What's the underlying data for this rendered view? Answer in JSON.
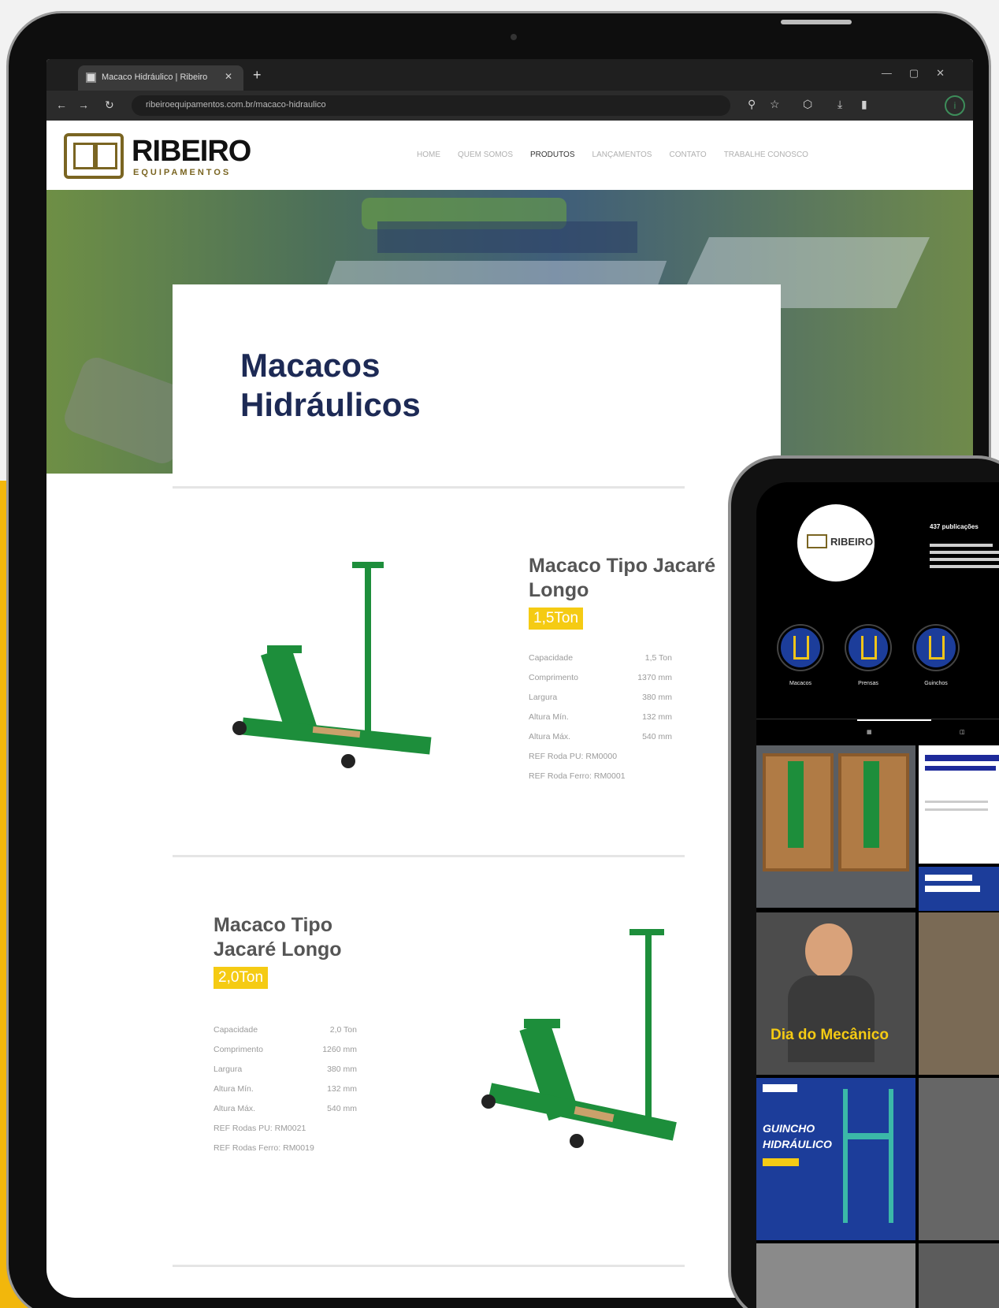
{
  "browser": {
    "tab_title": "Macaco Hidráulico | Ribeiro",
    "url": "ribeiroequipamentos.com.br/macaco-hidraulico",
    "profile_initial": "i"
  },
  "site": {
    "brand": "RIBEIRO",
    "brand_sub": "EQUIPAMENTOS",
    "menu": [
      "HOME",
      "QUEM SOMOS",
      "PRODUTOS",
      "LANÇAMENTOS",
      "CONTATO",
      "TRABALHE CONOSCO"
    ],
    "menu_active_index": 2
  },
  "page": {
    "title": "Macacos Hidráulicos"
  },
  "products": [
    {
      "title": "Macaco Tipo Jacaré Longo",
      "capacity_badge": "1,5Ton",
      "specs": [
        {
          "label": "Capacidade",
          "value": "1,5 Ton"
        },
        {
          "label": "Comprimento",
          "value": "1370 mm"
        },
        {
          "label": "Largura",
          "value": "380 mm"
        },
        {
          "label": "Altura Mín.",
          "value": "132 mm"
        },
        {
          "label": "Altura Máx.",
          "value": "540 mm"
        }
      ],
      "refs": [
        "REF Roda PU: RM0000",
        "REF Roda Ferro: RM0001"
      ]
    },
    {
      "title": "Macaco Tipo Jacaré Longo",
      "capacity_badge": "2,0Ton",
      "specs": [
        {
          "label": "Capacidade",
          "value": "2,0 Ton"
        },
        {
          "label": "Comprimento",
          "value": "1260 mm"
        },
        {
          "label": "Largura",
          "value": "380 mm"
        },
        {
          "label": "Altura Mín.",
          "value": "132 mm"
        },
        {
          "label": "Altura Máx.",
          "value": "540 mm"
        }
      ],
      "refs": [
        "REF Rodas PU: RM0021",
        "REF Rodas Ferro: RM0019"
      ]
    }
  ],
  "phone": {
    "avatar_text": "RIBEIRO",
    "posts_count": "437 publicações",
    "highlights": [
      "Macacos",
      "Prensas",
      "Guinchos"
    ],
    "posts": [
      {
        "text": "Dia do Mecânico"
      },
      {
        "text": "GUINCHO HIDRÁULICO"
      }
    ]
  },
  "colors": {
    "accent_yellow": "#f5cb13",
    "title_navy": "#1d2a55",
    "jack_green": "#1d8e3b",
    "brand_gold": "#7a6522"
  }
}
